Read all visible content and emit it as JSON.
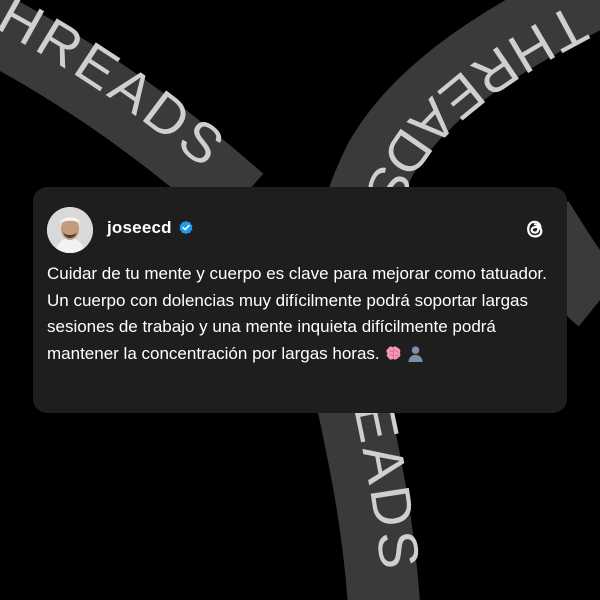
{
  "background": {
    "ribbon_text": "THREADS",
    "ribbon_color": "#3a3a3a",
    "ribbon_text_color": "#cfcfcf"
  },
  "post": {
    "username": "joseecd",
    "verified": true,
    "text": "Cuidar de tu mente y cuerpo es clave para mejorar como tatuador. Un cuerpo con dolencias muy difícilmente podrá soportar largas sesiones de trabajo y una mente inquieta difícilmente podrá mantener la concentración por largas horas.",
    "emojis": [
      "brain-icon",
      "bust-in-silhouette-icon"
    ],
    "accent_color": "#1d9bf0",
    "card_color": "#1e1e1e"
  },
  "brand_icon": "threads-logo-icon"
}
